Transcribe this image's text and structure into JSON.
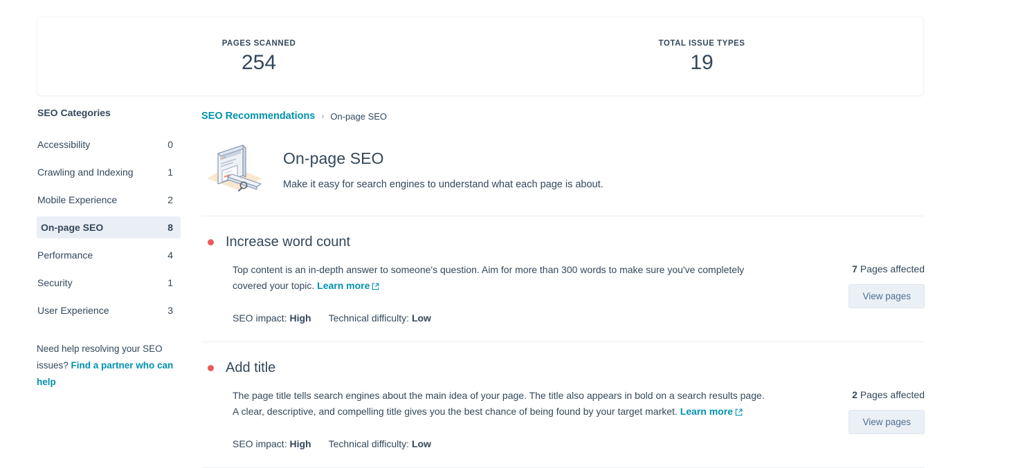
{
  "stats": [
    {
      "label": "PAGES SCANNED",
      "value": "254",
      "name": "pages-scanned"
    },
    {
      "label": "TOTAL ISSUE TYPES",
      "value": "19",
      "name": "total-issue-types"
    }
  ],
  "sidebar": {
    "title": "SEO Categories",
    "items": [
      {
        "label": "Accessibility",
        "count": "0"
      },
      {
        "label": "Crawling and Indexing",
        "count": "1"
      },
      {
        "label": "Mobile Experience",
        "count": "2"
      },
      {
        "label": "On-page SEO",
        "count": "8"
      },
      {
        "label": "Performance",
        "count": "4"
      },
      {
        "label": "Security",
        "count": "1"
      },
      {
        "label": "User Experience",
        "count": "3"
      }
    ],
    "active_index": 3,
    "help_text": "Need help resolving your SEO issues? ",
    "help_link": "Find a partner who can help"
  },
  "breadcrumb": {
    "root": "SEO Recommendations",
    "separator": "›",
    "current": "On-page SEO"
  },
  "page": {
    "title": "On-page SEO",
    "subtitle": "Make it easy for search engines to understand what each page is about.",
    "illustration": "browser-magnifier-illustration"
  },
  "issues": [
    {
      "title": "Increase word count",
      "body": "Top content is an in-depth answer to someone's question. Aim for more than 300 words to make sure you've completely covered your topic. ",
      "learn_more": "Learn more",
      "impact_label": "SEO impact:",
      "impact_value": "High",
      "difficulty_label": "Technical difficulty:",
      "difficulty_value": "Low",
      "affected_count": "7",
      "affected_label": " Pages affected",
      "button": "View pages",
      "status_color": "#ec5a5a"
    },
    {
      "title": "Add title",
      "body": "The page title tells search engines about the main idea of your page. The title also appears in bold on a search results page. A clear, descriptive, and compelling title gives you the best chance of being found by your target market. ",
      "learn_more": "Learn more",
      "impact_label": "SEO impact:",
      "impact_value": "High",
      "difficulty_label": "Technical difficulty:",
      "difficulty_value": "Low",
      "affected_count": "2",
      "affected_label": " Pages affected",
      "button": "View pages",
      "status_color": "#ec5a5a"
    }
  ],
  "colors": {
    "link": "#0091ae",
    "text": "#33475b",
    "active_bg": "#eaeff5",
    "status_red": "#ec5a5a",
    "button_bg": "#eaf0f6"
  }
}
